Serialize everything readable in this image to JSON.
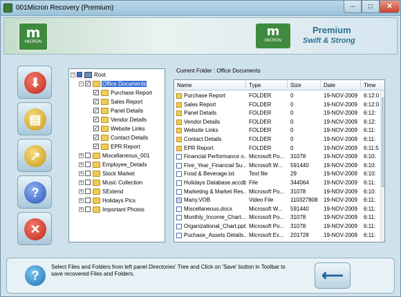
{
  "window": {
    "title": "001Micron Recovery (Premium)",
    "min_glyph": "–",
    "max_glyph": "□",
    "close_glyph": "✕"
  },
  "header": {
    "logo_glyph": "m",
    "logo_text": "MICRON",
    "premium": "Premium",
    "tagline": "Swift & Strong"
  },
  "toolbar": {
    "buttons": [
      {
        "name": "download-button",
        "glyph": "⬇"
      },
      {
        "name": "open-folder-button",
        "glyph": "▤"
      },
      {
        "name": "save-folder-button",
        "glyph": "↗"
      },
      {
        "name": "help-button",
        "glyph": "?"
      },
      {
        "name": "exit-button",
        "glyph": "✕"
      }
    ]
  },
  "tree": {
    "root": "Root",
    "items": [
      {
        "label": "Office Documents",
        "level": 1,
        "checked": true,
        "selected": true,
        "expanded": true
      },
      {
        "label": "Purchase Report",
        "level": 2,
        "checked": true
      },
      {
        "label": "Sales Report",
        "level": 2,
        "checked": true
      },
      {
        "label": "Panel Details",
        "level": 2,
        "checked": true
      },
      {
        "label": "Vendor Details",
        "level": 2,
        "checked": true
      },
      {
        "label": "Website Links",
        "level": 2,
        "checked": true
      },
      {
        "label": "Contact Details",
        "level": 2,
        "checked": true
      },
      {
        "label": "EPR Report",
        "level": 2,
        "checked": true
      },
      {
        "label": "Miscellaneous_001",
        "level": 1,
        "checked": false
      },
      {
        "label": "Employee_Details",
        "level": 1,
        "checked": false
      },
      {
        "label": "Stock Market",
        "level": 1,
        "checked": false
      },
      {
        "label": "Music Collection",
        "level": 1,
        "checked": false
      },
      {
        "label": "SExtend",
        "level": 1,
        "checked": false
      },
      {
        "label": "Holidays Pics",
        "level": 1,
        "checked": false
      },
      {
        "label": "Important Photos",
        "level": 1,
        "checked": false
      }
    ]
  },
  "current_folder": "Current Folder : Office Documents",
  "list": {
    "columns": [
      "Name",
      "Type",
      "Size",
      "Date",
      "Time"
    ],
    "rows": [
      {
        "name": "Purchase Report",
        "type": "FOLDER",
        "size": "0",
        "date": "19-NOV-2009",
        "time": "6:12:0",
        "icon": "folder"
      },
      {
        "name": "Sales Report",
        "type": "FOLDER",
        "size": "0",
        "date": "19-NOV-2009",
        "time": "6:12:0",
        "icon": "folder"
      },
      {
        "name": "Panel Details",
        "type": "FOLDER",
        "size": "0",
        "date": "19-NOV-2009",
        "time": "6:12:",
        "icon": "folder"
      },
      {
        "name": "Vendor Details",
        "type": "FOLDER",
        "size": "0",
        "date": "19-NOV-2009",
        "time": "6:12:",
        "icon": "folder"
      },
      {
        "name": "Website Links",
        "type": "FOLDER",
        "size": "0",
        "date": "19-NOV-2009",
        "time": "6:11:",
        "icon": "folder"
      },
      {
        "name": "Contact Details",
        "type": "FOLDER",
        "size": "0",
        "date": "19-NOV-2009",
        "time": "6:11:",
        "icon": "folder"
      },
      {
        "name": "EPR Report",
        "type": "FOLDER",
        "size": "0",
        "date": "19-NOV-2009",
        "time": "6:11:5",
        "icon": "folder"
      },
      {
        "name": "Financial Performance o...",
        "type": "Microsoft Po...",
        "size": "31078",
        "date": "19-NOV-2009",
        "time": "6:10:",
        "icon": "doc"
      },
      {
        "name": "Five_Year_Financial Su...",
        "type": "Microsoft W...",
        "size": "591440",
        "date": "19-NOV-2009",
        "time": "6:10:",
        "icon": "doc"
      },
      {
        "name": "Food & Beverage.txt",
        "type": "Text file",
        "size": "29",
        "date": "19-NOV-2009",
        "time": "6:10:",
        "icon": "doc"
      },
      {
        "name": "Holidays Database.accdb",
        "type": "File",
        "size": "344064",
        "date": "19-NOV-2009",
        "time": "6:11:",
        "icon": "doc"
      },
      {
        "name": "Marketing & Market Res...",
        "type": "Microsoft Po...",
        "size": "31078",
        "date": "19-NOV-2009",
        "time": "6:10:",
        "icon": "doc"
      },
      {
        "name": "Many.VOB",
        "type": "Video File",
        "size": "110327808",
        "date": "19-NOV-2009",
        "time": "6:11:",
        "icon": "img"
      },
      {
        "name": "Miscellaneous.docx",
        "type": "Microsoft W...",
        "size": "591440",
        "date": "19-NOV-2009",
        "time": "6:11:",
        "icon": "doc"
      },
      {
        "name": "Monthly_Income_Chart...",
        "type": "Microsoft Po...",
        "size": "31078",
        "date": "19-NOV-2009",
        "time": "6:11:",
        "icon": "doc"
      },
      {
        "name": "Organizational_Chart.pptx",
        "type": "Microsoft Po...",
        "size": "31078",
        "date": "19-NOV-2009",
        "time": "6:11:",
        "icon": "doc"
      },
      {
        "name": "Puchase_Assets Details...",
        "type": "Microsoft Ex...",
        "size": "201728",
        "date": "19-NOV-2009",
        "time": "6:11:",
        "icon": "doc"
      }
    ]
  },
  "status": {
    "help_glyph": "?",
    "message": "Select Files and Folders from left panel Directories' Tree and Click on 'Save' button in Toolbar to save recovered Files and Folders.",
    "back_glyph": "⟵"
  },
  "colors": {
    "selection": "#3a6ed0",
    "brand_green": "#3f8a3f",
    "brand_blue": "#2a6f8f"
  }
}
